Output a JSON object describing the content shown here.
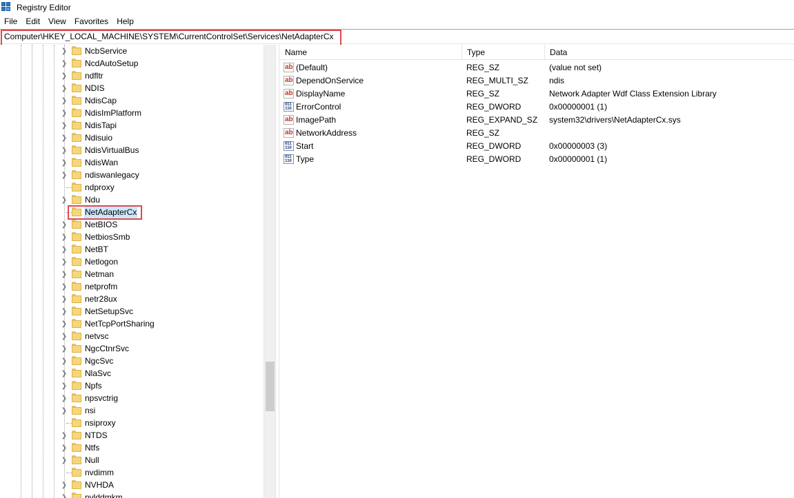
{
  "window": {
    "title": "Registry Editor"
  },
  "menu": [
    "File",
    "Edit",
    "View",
    "Favorites",
    "Help"
  ],
  "address": {
    "path": "Computer\\HKEY_LOCAL_MACHINE\\SYSTEM\\CurrentControlSet\\Services\\NetAdapterCx"
  },
  "tree": {
    "selected": "NetAdapterCx",
    "items": [
      {
        "label": "NcbService",
        "expandable": true
      },
      {
        "label": "NcdAutoSetup",
        "expandable": true
      },
      {
        "label": "ndfltr",
        "expandable": true
      },
      {
        "label": "NDIS",
        "expandable": true
      },
      {
        "label": "NdisCap",
        "expandable": true
      },
      {
        "label": "NdisImPlatform",
        "expandable": true
      },
      {
        "label": "NdisTapi",
        "expandable": true
      },
      {
        "label": "Ndisuio",
        "expandable": true
      },
      {
        "label": "NdisVirtualBus",
        "expandable": true
      },
      {
        "label": "NdisWan",
        "expandable": true
      },
      {
        "label": "ndiswanlegacy",
        "expandable": true
      },
      {
        "label": "ndproxy",
        "expandable": false
      },
      {
        "label": "Ndu",
        "expandable": true
      },
      {
        "label": "NetAdapterCx",
        "expandable": false
      },
      {
        "label": "NetBIOS",
        "expandable": true
      },
      {
        "label": "NetbiosSmb",
        "expandable": true
      },
      {
        "label": "NetBT",
        "expandable": true
      },
      {
        "label": "Netlogon",
        "expandable": true
      },
      {
        "label": "Netman",
        "expandable": true
      },
      {
        "label": "netprofm",
        "expandable": true
      },
      {
        "label": "netr28ux",
        "expandable": true
      },
      {
        "label": "NetSetupSvc",
        "expandable": true
      },
      {
        "label": "NetTcpPortSharing",
        "expandable": true
      },
      {
        "label": "netvsc",
        "expandable": true
      },
      {
        "label": "NgcCtnrSvc",
        "expandable": true
      },
      {
        "label": "NgcSvc",
        "expandable": true
      },
      {
        "label": "NlaSvc",
        "expandable": true
      },
      {
        "label": "Npfs",
        "expandable": true
      },
      {
        "label": "npsvctrig",
        "expandable": true
      },
      {
        "label": "nsi",
        "expandable": true
      },
      {
        "label": "nsiproxy",
        "expandable": false
      },
      {
        "label": "NTDS",
        "expandable": true
      },
      {
        "label": "Ntfs",
        "expandable": true
      },
      {
        "label": "Null",
        "expandable": true
      },
      {
        "label": "nvdimm",
        "expandable": false
      },
      {
        "label": "NVHDA",
        "expandable": true
      },
      {
        "label": "nvlddmkm",
        "expandable": true
      }
    ]
  },
  "list": {
    "columns": {
      "name": "Name",
      "type": "Type",
      "data": "Data"
    },
    "values": [
      {
        "icon": "string-value-icon",
        "badge": "ab",
        "name": "(Default)",
        "type": "REG_SZ",
        "data": "(value not set)"
      },
      {
        "icon": "string-value-icon",
        "badge": "ab",
        "name": "DependOnService",
        "type": "REG_MULTI_SZ",
        "data": "ndis"
      },
      {
        "icon": "string-value-icon",
        "badge": "ab",
        "name": "DisplayName",
        "type": "REG_SZ",
        "data": "Network Adapter Wdf Class Extension Library"
      },
      {
        "icon": "binary-value-icon",
        "badge": "011\n110",
        "name": "ErrorControl",
        "type": "REG_DWORD",
        "data": "0x00000001 (1)"
      },
      {
        "icon": "string-value-icon",
        "badge": "ab",
        "name": "ImagePath",
        "type": "REG_EXPAND_SZ",
        "data": "system32\\drivers\\NetAdapterCx.sys"
      },
      {
        "icon": "string-value-icon",
        "badge": "ab",
        "name": "NetworkAddress",
        "type": "REG_SZ",
        "data": ""
      },
      {
        "icon": "binary-value-icon",
        "badge": "011\n110",
        "name": "Start",
        "type": "REG_DWORD",
        "data": "0x00000003 (3)"
      },
      {
        "icon": "binary-value-icon",
        "badge": "011\n110",
        "name": "Type",
        "type": "REG_DWORD",
        "data": "0x00000001 (1)"
      }
    ]
  },
  "colors": {
    "highlight": "#e0474c",
    "selection": "#cce8ff",
    "folder": "#f5d77a"
  }
}
